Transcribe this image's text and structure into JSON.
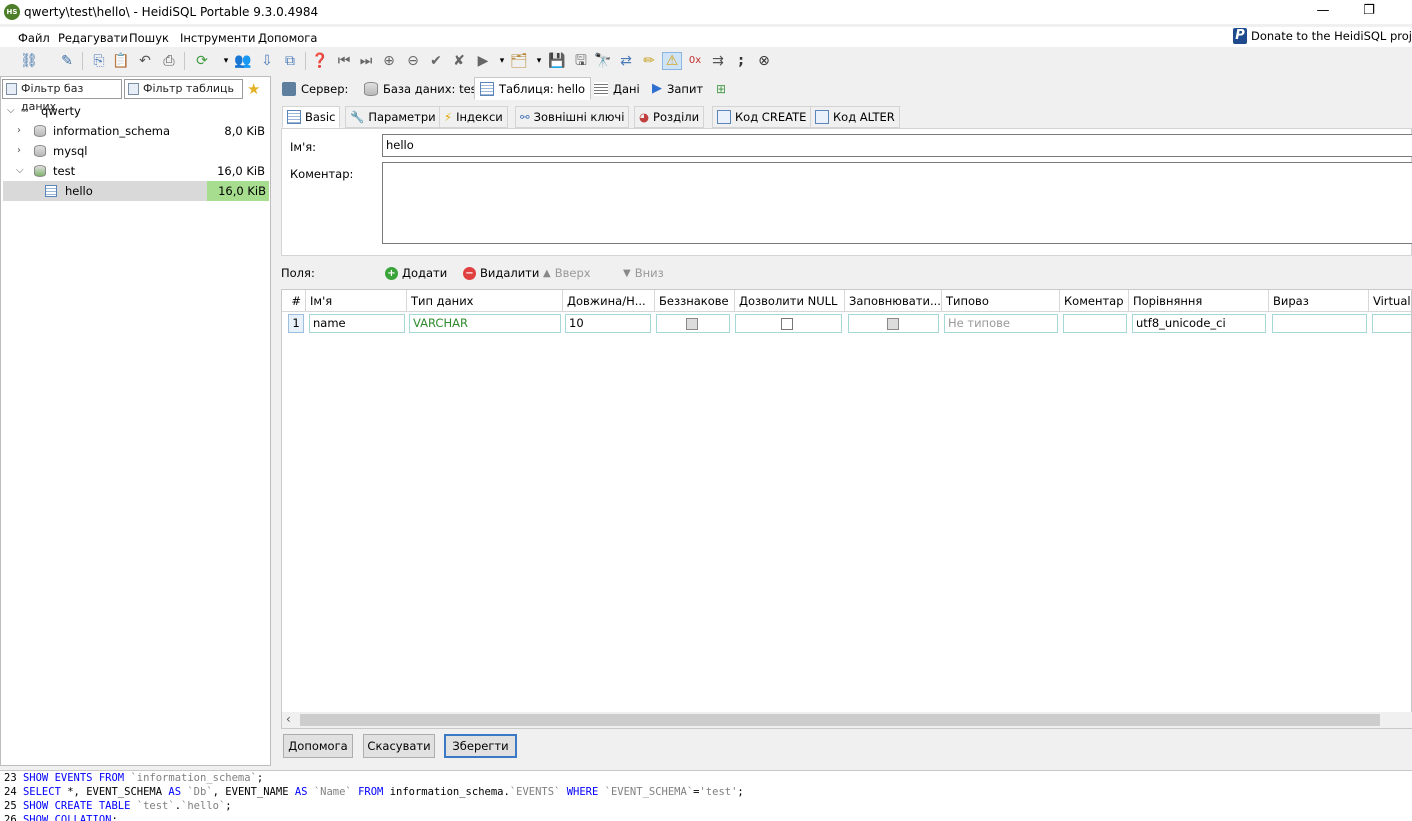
{
  "window": {
    "title": "qwerty\\test\\hello\\ - HeidiSQL Portable 9.3.0.4984",
    "minimize": "—",
    "maximize": "❐",
    "close": "✕"
  },
  "menu": [
    "Файл",
    "Редагувати",
    "Пошук",
    "Інструменти",
    "Допомога"
  ],
  "donate": "Donate to the HeidiSQL proj",
  "filters": {
    "db": "Фільтр баз даних",
    "table": "Фільтр таблиць"
  },
  "tree": {
    "root": "qwerty",
    "items": [
      {
        "label": "information_schema",
        "size": "8,0 KiB"
      },
      {
        "label": "mysql",
        "size": ""
      },
      {
        "label": "test",
        "size": "16,0 KiB"
      },
      {
        "label": "hello",
        "size": "16,0 KiB"
      }
    ]
  },
  "main_tabs": [
    "Сервер:",
    "База даних: test",
    "Таблиця: hello",
    "Дані",
    "Запит"
  ],
  "sub_tabs": [
    "Basic",
    "Параметри",
    "Індекси",
    "Зовнішні ключі",
    "Розділи",
    "Код CREATE",
    "Код ALTER"
  ],
  "basic": {
    "name_label": "Ім'я:",
    "name_value": "hello",
    "comment_label": "Коментар:",
    "comment_value": ""
  },
  "fields_bar": {
    "label": "Поля:",
    "add": "Додати",
    "remove": "Видалити",
    "up": "Вверх",
    "down": "Вниз"
  },
  "grid": {
    "headers": [
      "#",
      "Ім'я",
      "Тип даних",
      "Довжина/Н...",
      "Беззнакове",
      "Дозволити NULL",
      "Заповнювати...",
      "Типово",
      "Коментар",
      "Порівняння",
      "Вираз",
      "Virtualit"
    ],
    "rows": [
      {
        "num": "1",
        "name": "name",
        "type": "VARCHAR",
        "length": "10",
        "unsigned": false,
        "allow_null": false,
        "zerofill": false,
        "default": "Не типове",
        "comment": "",
        "collation": "utf8_unicode_ci",
        "expression": "",
        "virtuality": ""
      }
    ]
  },
  "buttons": {
    "help": "Допомога",
    "cancel": "Скасувати",
    "save": "Зберегти"
  },
  "log": [
    {
      "n": "23",
      "parts": [
        [
          "kw",
          "SHOW EVENTS FROM "
        ],
        [
          "str",
          "`information_schema`"
        ],
        [
          "",
          "; "
        ]
      ]
    },
    {
      "n": "24",
      "parts": [
        [
          "kw",
          "SELECT "
        ],
        [
          "",
          "*, EVENT_SCHEMA "
        ],
        [
          "kw",
          "AS "
        ],
        [
          "str",
          "`Db`"
        ],
        [
          "",
          ", EVENT_NAME "
        ],
        [
          "kw",
          "AS "
        ],
        [
          "str",
          "`Name`"
        ],
        [
          "kw",
          " FROM "
        ],
        [
          "",
          "information_schema."
        ],
        [
          "str",
          "`EVENTS`"
        ],
        [
          "kw",
          " WHERE "
        ],
        [
          "str",
          "`EVENT_SCHEMA`"
        ],
        [
          "",
          "="
        ],
        [
          "str",
          "'test'"
        ],
        [
          "",
          ";"
        ]
      ]
    },
    {
      "n": "25",
      "parts": [
        [
          "kw",
          "SHOW CREATE TABLE "
        ],
        [
          "str",
          "`test`"
        ],
        [
          "",
          "."
        ],
        [
          "str",
          "`hello`"
        ],
        [
          "",
          ";"
        ]
      ]
    },
    {
      "n": "26",
      "parts": [
        [
          "kw",
          "SHOW COLLATION"
        ],
        [
          "",
          ";"
        ]
      ]
    }
  ],
  "colors": {
    "selection_size_bg": "#a7dd8f",
    "cell_border": "#a6d8d6",
    "type_text": "#2e8b2e",
    "accent": "#3b79c7"
  }
}
